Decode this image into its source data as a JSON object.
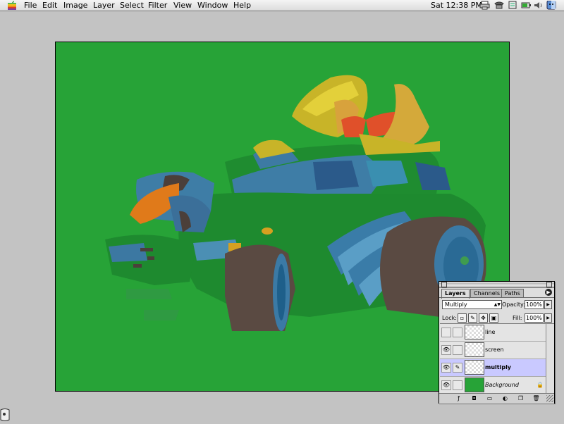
{
  "menubar": {
    "items": [
      "File",
      "Edit",
      "Image",
      "Layer",
      "Select",
      "Filter",
      "View",
      "Window",
      "Help"
    ],
    "clock": "Sat 12:38 PM",
    "status_icons": [
      "printer-icon",
      "phone-icon",
      "control-strip-icon",
      "battery-icon",
      "speaker-icon",
      "finder-icon"
    ]
  },
  "document": {
    "background_color": "#27a337"
  },
  "layers_palette": {
    "tabs": [
      "Layers",
      "Channels",
      "Paths"
    ],
    "active_tab": "Layers",
    "blend_mode": "Multiply",
    "opacity_label": "Opacity:",
    "opacity_value": "100%",
    "lock_label": "Lock:",
    "fill_label": "Fill:",
    "fill_value": "100%",
    "layers": [
      {
        "name": "line",
        "visible": false,
        "active": false
      },
      {
        "name": "screen",
        "visible": true,
        "active": false
      },
      {
        "name": "multiply",
        "visible": true,
        "active": true
      },
      {
        "name": "Background",
        "visible": true,
        "active": false
      }
    ]
  }
}
